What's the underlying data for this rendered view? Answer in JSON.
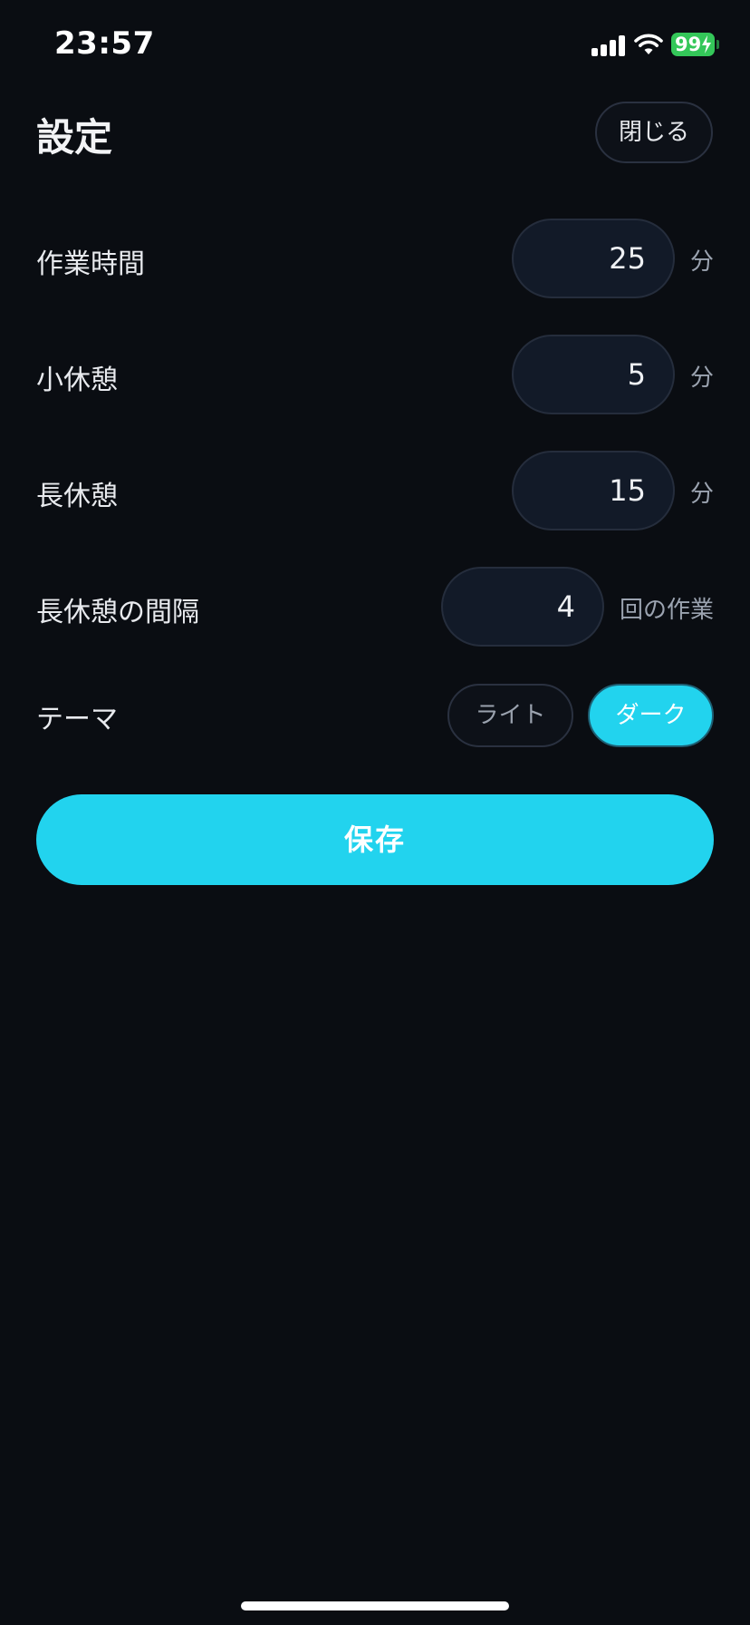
{
  "status_bar": {
    "time": "23:57",
    "battery": "99",
    "signal_icon": "cellular-signal-icon",
    "wifi_icon": "wifi-icon",
    "battery_icon": "battery-charging-icon"
  },
  "header": {
    "title": "設定",
    "close_label": "閉じる"
  },
  "settings": {
    "work": {
      "label": "作業時間",
      "value": "25",
      "unit": "分"
    },
    "short_break": {
      "label": "小休憩",
      "value": "5",
      "unit": "分"
    },
    "long_break": {
      "label": "長休憩",
      "value": "15",
      "unit": "分"
    },
    "interval": {
      "label": "長休憩の間隔",
      "value": "4",
      "unit": "回の作業"
    }
  },
  "theme": {
    "label": "テーマ",
    "options": [
      "ライト",
      "ダーク"
    ],
    "selected": "ダーク"
  },
  "save_label": "保存",
  "colors": {
    "background": "#0a0d12",
    "accent": "#22d3ee",
    "battery": "#34c759"
  }
}
